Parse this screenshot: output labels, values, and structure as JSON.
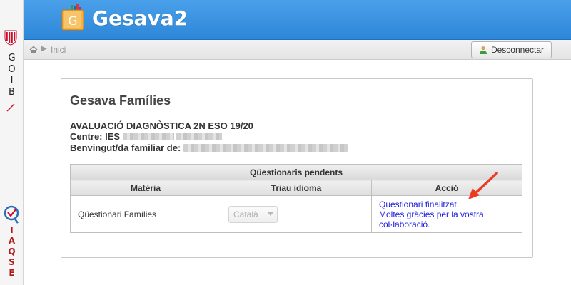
{
  "brand": {
    "side_top_letters": [
      "G",
      "O",
      "I",
      "B"
    ],
    "side_bottom_letters": [
      "I",
      "A",
      "Q",
      "S",
      "E"
    ]
  },
  "header": {
    "app_icon_letter": "G",
    "title": "Gesava2"
  },
  "breadcrumb": {
    "home": "Inici"
  },
  "toolbar": {
    "logout_label": "Desconnectar"
  },
  "panel": {
    "title": "Gesava Famílies",
    "exam_label": "AVALUACIÓ DIAGNÒSTICA 2N ESO 19/20",
    "centre_label": "Centre: IES",
    "family_label": "Benvingut/da familiar de:"
  },
  "table": {
    "caption": "Qüestionaris pendents",
    "headers": [
      "Matèria",
      "Triau idioma",
      "Acció"
    ],
    "rows": [
      {
        "name": "Qüestionari Famílies",
        "language": "Català",
        "action_lines": [
          "Questionari finalitzat.",
          "Moltes gràcies per la vostra",
          "col·laboració."
        ]
      }
    ]
  },
  "colors": {
    "header": "#3a93e2",
    "link": "#1a1adf",
    "annotation_arrow": "#ec3b1f"
  }
}
